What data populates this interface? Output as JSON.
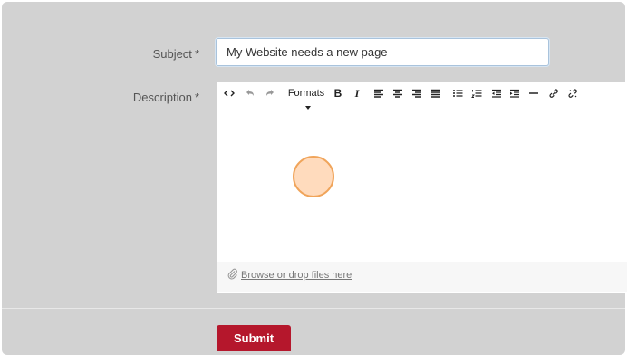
{
  "form": {
    "subject_label": "Subject",
    "description_label": "Description",
    "required_mark": "*",
    "subject_value": "My Website needs a new page",
    "attach_text": "Browse or drop files here",
    "submit_label": "Submit"
  },
  "toolbar": {
    "formats_label": "Formats",
    "bold_label": "B",
    "italic_label": "I",
    "icons": [
      "code-icon",
      "undo-icon",
      "redo-icon",
      "formats-dropdown",
      "bold-icon",
      "italic-icon",
      "align-left-icon",
      "align-center-icon",
      "align-right-icon",
      "align-justify-icon",
      "bullet-list-icon",
      "numbered-list-icon",
      "outdent-icon",
      "indent-icon",
      "horizontal-rule-icon",
      "link-icon",
      "unlink-icon"
    ]
  },
  "colors": {
    "panel": "#d2d2d2",
    "submit": "#b5172c",
    "cursor_fill": "#ffd5b2",
    "cursor_border": "#f0a45a"
  }
}
